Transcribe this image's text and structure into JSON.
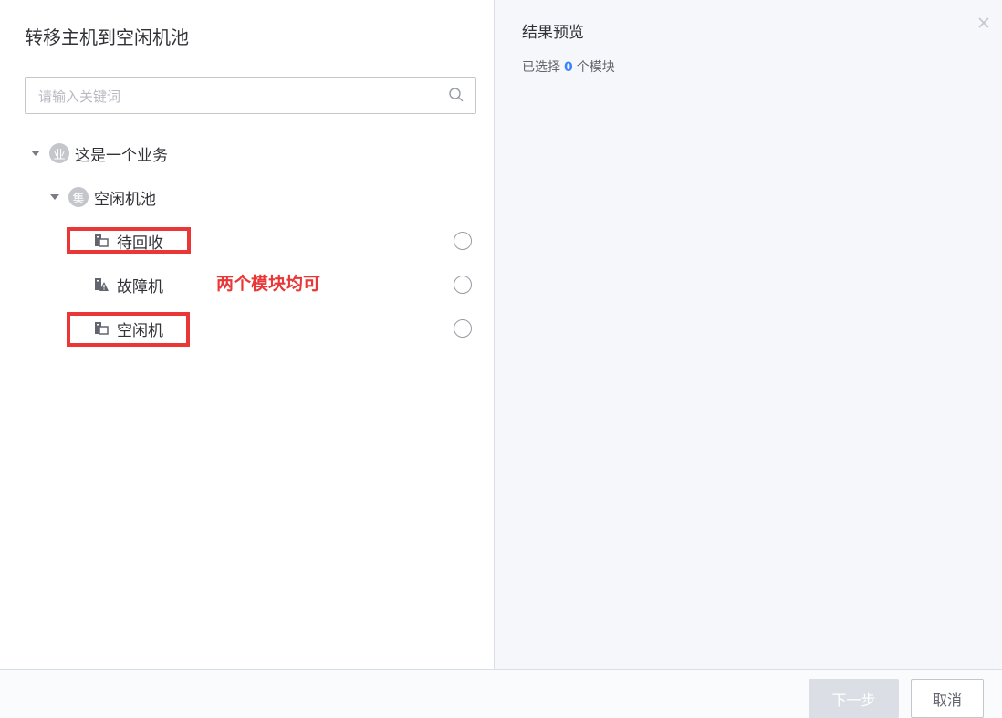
{
  "dialog": {
    "title": "转移主机到空闲机池"
  },
  "search": {
    "placeholder": "请输入关键词",
    "value": ""
  },
  "tree": {
    "business": {
      "badge": "业",
      "label": "这是一个业务"
    },
    "set": {
      "badge": "集",
      "label": "空闲机池"
    },
    "modules": [
      {
        "label": "待回收",
        "icon": "module-icon",
        "selected": false
      },
      {
        "label": "故障机",
        "icon": "fault-module-icon",
        "selected": false
      },
      {
        "label": "空闲机",
        "icon": "module-icon",
        "selected": false
      }
    ]
  },
  "annotation": {
    "text": "两个模块均可",
    "color": "#ea3636"
  },
  "preview": {
    "title": "结果预览",
    "summary_prefix": "已选择",
    "count": "0",
    "summary_suffix": "个模块"
  },
  "footer": {
    "next_label": "下一步",
    "cancel_label": "取消"
  },
  "colors": {
    "accent": "#3a84ff",
    "highlight": "#ea3636",
    "disabled_button": "#dcdee5",
    "preview_background": "#f5f7fa"
  }
}
